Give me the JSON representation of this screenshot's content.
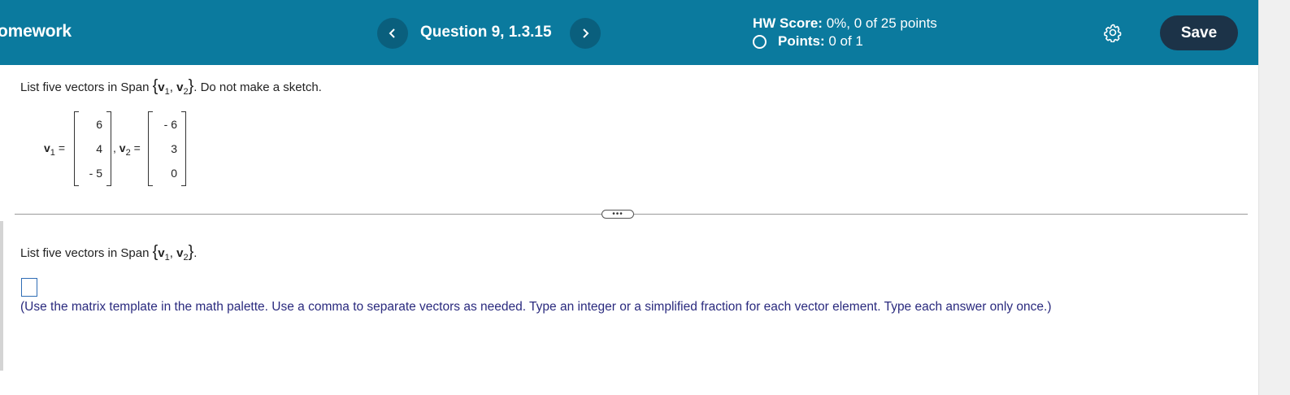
{
  "header": {
    "app_title": "omework",
    "question_title": "Question 9, 1.3.15",
    "prev_label": "Previous question",
    "next_label": "Next question",
    "hw_score_label": "HW Score:",
    "hw_score_value": "0%, 0 of 25 points",
    "points_label": "Points:",
    "points_value": "0 of 1",
    "settings_icon": "gear-icon",
    "save_label": "Save",
    "bg_color": "#0b7a9e",
    "save_color": "#1c3348"
  },
  "problem": {
    "intro_text": "List five vectors in Span",
    "intro_suffix": ". Do not make a sketch.",
    "span_v1": "v",
    "span_v1_sub": "1",
    "span_v2": "v",
    "span_v2_sub": "2",
    "v1_label": "v",
    "v1_sub": "1",
    "v2_label": "v",
    "v2_sub": "2",
    "equals": "=",
    "comma": ",",
    "v1_values": [
      "6",
      "4",
      "- 5"
    ],
    "v2_values": [
      "- 6",
      "3",
      "0"
    ]
  },
  "answer": {
    "prompt_text": "List five vectors in Span",
    "prompt_suffix": ".",
    "hint": "(Use the matrix template in the math palette. Use a comma to separate vectors as needed. Type an integer or a simplified fraction for each vector element. Type each answer only once.)"
  }
}
